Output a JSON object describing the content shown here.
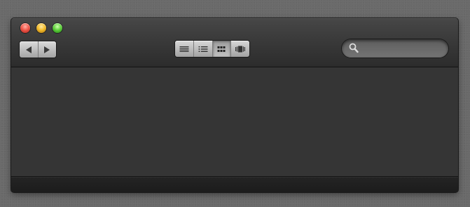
{
  "window": {
    "title": "",
    "controls": {
      "close": {
        "icon": "close-circle-icon",
        "color": "#f0584a"
      },
      "minimize": {
        "icon": "minimize-circle-icon",
        "color": "#f3bd2c"
      },
      "zoom": {
        "icon": "zoom-circle-icon",
        "color": "#5fd13c"
      }
    }
  },
  "toolbar": {
    "navigation": {
      "back": {
        "icon": "triangle-left-icon"
      },
      "forward": {
        "icon": "triangle-right-icon"
      }
    },
    "view_modes": [
      {
        "id": "list",
        "icon": "list-view-icon",
        "selected": false
      },
      {
        "id": "detail",
        "icon": "detail-list-view-icon",
        "selected": false
      },
      {
        "id": "icon",
        "icon": "icon-grid-view-icon",
        "selected": true
      },
      {
        "id": "coverflow",
        "icon": "coverflow-view-icon",
        "selected": false
      }
    ],
    "search": {
      "icon": "search-icon",
      "value": "",
      "placeholder": ""
    }
  },
  "content": {
    "items": []
  },
  "statusbar": {
    "text": ""
  },
  "colors": {
    "background": "#6a6a6a",
    "window": "#353535",
    "titlebar_top": "#474747",
    "statusbar": "#1f1f1f"
  }
}
